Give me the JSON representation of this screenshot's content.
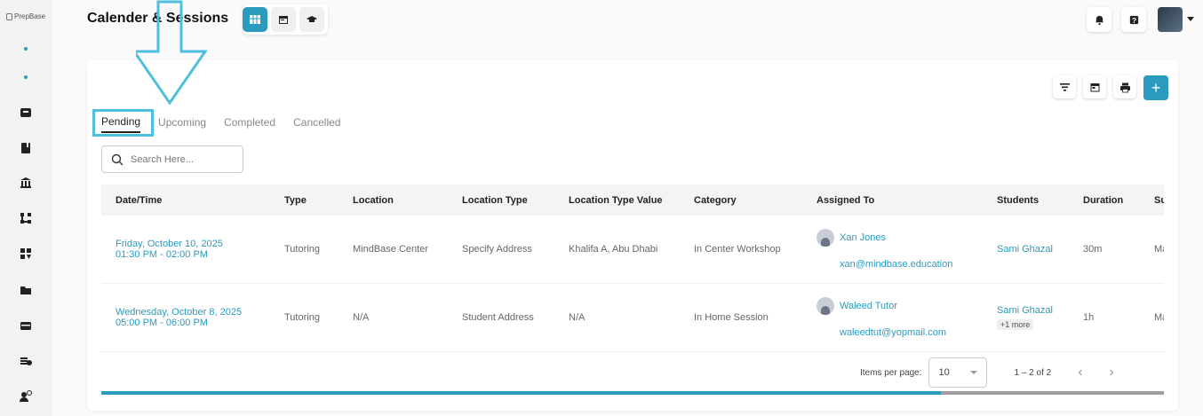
{
  "app": {
    "logo_text": "PrepBase"
  },
  "header": {
    "title": "Calender & Sessions"
  },
  "tabs": [
    {
      "label": "Pending"
    },
    {
      "label": "Upcoming"
    },
    {
      "label": "Completed"
    },
    {
      "label": "Cancelled"
    }
  ],
  "search": {
    "placeholder": "Search Here..."
  },
  "table": {
    "columns": [
      "Date/Time",
      "Type",
      "Location",
      "Location Type",
      "Location Type Value",
      "Category",
      "Assigned To",
      "Students",
      "Duration",
      "Su"
    ],
    "rows": [
      {
        "date": "Friday, October 10, 2025",
        "time": "01:30 PM - 02:00 PM",
        "type": "Tutoring",
        "location": "MindBase Center",
        "location_type": "Specify Address",
        "location_type_value": "Khalifa A, Abu Dhabi",
        "category": "In Center Workshop",
        "assigned_name": "Xan Jones",
        "assigned_email": "xan@mindbase.education",
        "students": "Sami Ghazal",
        "students_more": "",
        "duration": "30m",
        "su": "Ma"
      },
      {
        "date": "Wednesday, October 8, 2025",
        "time": "05:00 PM - 06:00 PM",
        "type": "Tutoring",
        "location": "N/A",
        "location_type": "Student Address",
        "location_type_value": "N/A",
        "category": "In Home Session",
        "assigned_name": "Waleed Tutor",
        "assigned_email": "waleedtut@yopmail.com",
        "students": "Sami Ghazal",
        "students_more": "+1 more",
        "duration": "1h",
        "su": "Ma"
      }
    ]
  },
  "pagination": {
    "items_per_page_label": "Items per page:",
    "items_per_page": "10",
    "range": "1 – 2 of 2",
    "progress_fraction": 0.79
  },
  "colors": {
    "accent": "#2a9bbd",
    "highlight": "#4fbfe0"
  }
}
